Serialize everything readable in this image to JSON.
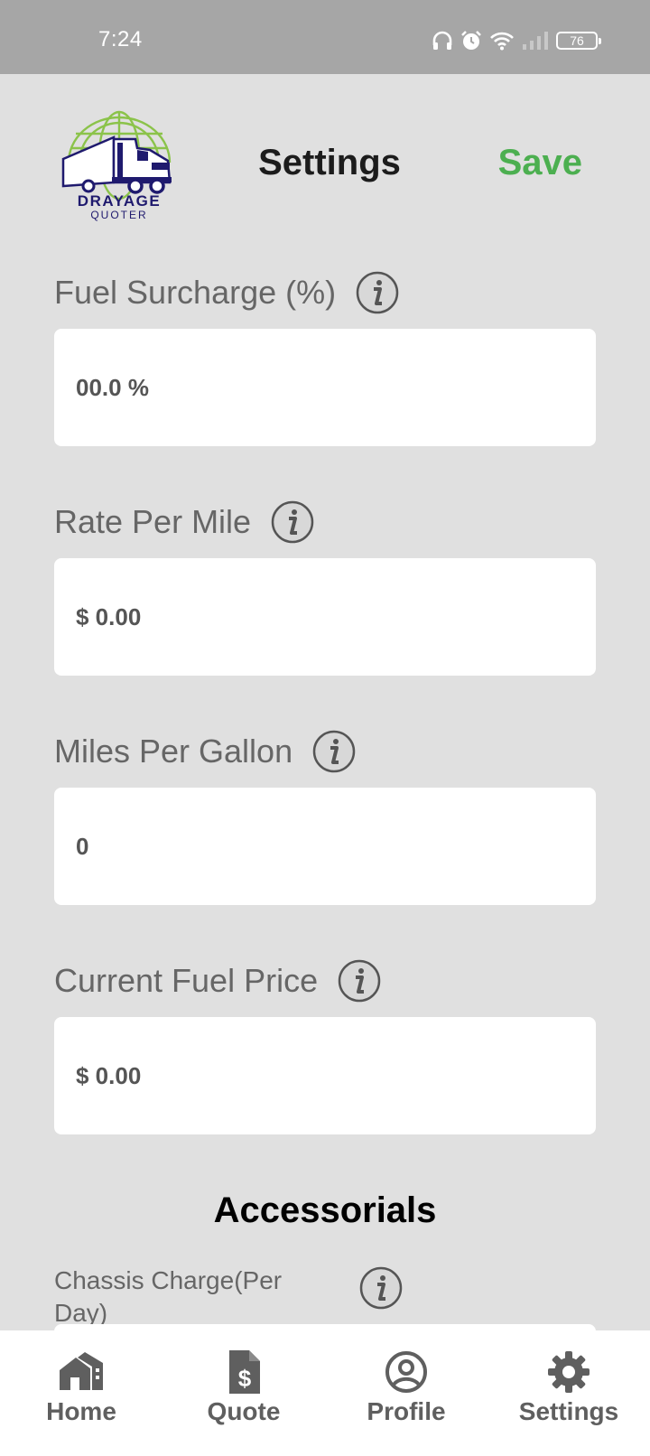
{
  "status_bar": {
    "time": "7:24",
    "battery": "76",
    "icons": [
      "headphones-icon",
      "alarm-icon",
      "wifi-icon",
      "signal-icon",
      "battery-icon"
    ]
  },
  "header": {
    "logo": {
      "line1": "DRAYAGE",
      "line2": "QUOTER"
    },
    "title": "Settings",
    "save_label": "Save"
  },
  "fields": [
    {
      "label": "Fuel Surcharge (%)",
      "value": "00.0 %",
      "icon": "info-icon"
    },
    {
      "label": "Rate Per Mile",
      "value": "$ 0.00",
      "icon": "info-icon"
    },
    {
      "label": "Miles Per Gallon",
      "value": "0",
      "icon": "info-icon"
    },
    {
      "label": "Current Fuel Price",
      "value": "$ 0.00",
      "icon": "info-icon"
    }
  ],
  "accessorials": {
    "title": "Accessorials",
    "chassis_label": "Chassis Charge(Per Day)"
  },
  "bottom_nav": [
    {
      "label": "Home",
      "icon": "home-icon"
    },
    {
      "label": "Quote",
      "icon": "quote-document-icon"
    },
    {
      "label": "Profile",
      "icon": "profile-icon"
    },
    {
      "label": "Settings",
      "icon": "gear-icon"
    }
  ],
  "colors": {
    "accent": "#4caf50",
    "background": "#e0e0e0",
    "status_bar": "#a6a6a6",
    "logo_navy": "#1f1a6e",
    "logo_green": "#8bc34a"
  }
}
